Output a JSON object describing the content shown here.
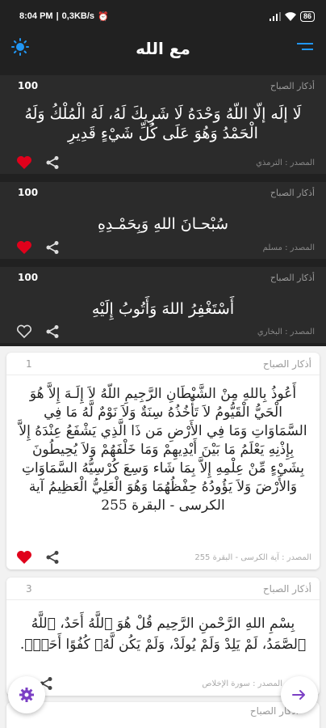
{
  "status": {
    "time": "8:04 PM",
    "speed": "0,3KB/s",
    "battery": "86"
  },
  "appbar": {
    "title": "مع الله"
  },
  "colors": {
    "accent_blue": "#2196f3",
    "heart_red": "#e0001b",
    "purple": "#7b3fc4"
  },
  "dark_cards": [
    {
      "count": "100",
      "category": "أذكار الصباح",
      "text_line1": "لَا إلَه إلّا اللّهُ وَحْدَهُ لَا شَرِيكَ لَهُ، لَهُ الْمُلْكُ وَلَهُ",
      "text_line2": "الْحَمْدُ وَهُوَ عَلَى كُلِّ شَيْءٍ قَدِيرِ",
      "source": "المصدر : الترمذي",
      "favorite": true
    },
    {
      "count": "100",
      "category": "أذكار الصباح",
      "text_line1": "سُبْحـانَ اللهِ وَبِحَمْـدِهِ",
      "source": "المصدر : مسلم",
      "favorite": true
    },
    {
      "count": "100",
      "category": "أذكار الصباح",
      "text_line1": "أَسْتَغْفِرُ اللهَ وَأَتُوبُ إِلَيْهِ",
      "source": "المصدر : البخاري",
      "favorite": false
    }
  ],
  "light_cards": [
    {
      "num": "1",
      "category": "أذكار الصباح",
      "text": "أَعُوذُ بِاللهِ مِنْ الشَّيْطَانِ الرَّجِيمِ اللّهُ لاَ إِلَـهَ إِلاَّ هُوَ الْحَيُّ الْقَيُّومُ لاَ تَأْخُذُهُ سِنَةٌ وَلاَ نَوْمٌ لَّهُ مَا فِي السَّمَاوَاتِ وَمَا فِي الأَرْضِ مَن ذَا الَّذِي يَشْفَعُ عِنْدَهُ إِلاَّ بِإِذْنِهِ يَعْلَمُ مَا بَيْنَ أَيْدِيهِمْ وَمَا خَلْفَهُمْ وَلاَ يُحِيطُونَ بِشَيْءٍ مِّنْ عِلْمِهِ إِلاَّ بِمَا شَاء وَسِعَ كُرْسِيُّهُ السَّمَاوَاتِ وَالأَرْضَ وَلاَ يَؤُودُهُ حِفْظُهُمَا وَهُوَ الْعَلِيُّ الْعَظِيمُ آية الكرسى - البقرة 255",
      "source": "المصدر : آية الكرسى - البقرة 255",
      "favorite": true
    },
    {
      "num": "3",
      "category": "أذكار الصباح",
      "text": "بِسْمِ اللهِ الرَّحْمنِ الرَّحِيم قُلْ هُوَ ٱللَّهُ أَحَدٌ، ٱللَّهُ ٱلصَّمَدُ، لَمْ يَلِدْ وَلَمْ يُولَدْ، وَلَمْ يَكُن لَّهُۥ كُفُوًا أَحَدٌۢ.",
      "source": "المصدر : سورة الإخلاص",
      "favorite": false
    },
    {
      "category": "أذكار الصباح"
    }
  ]
}
